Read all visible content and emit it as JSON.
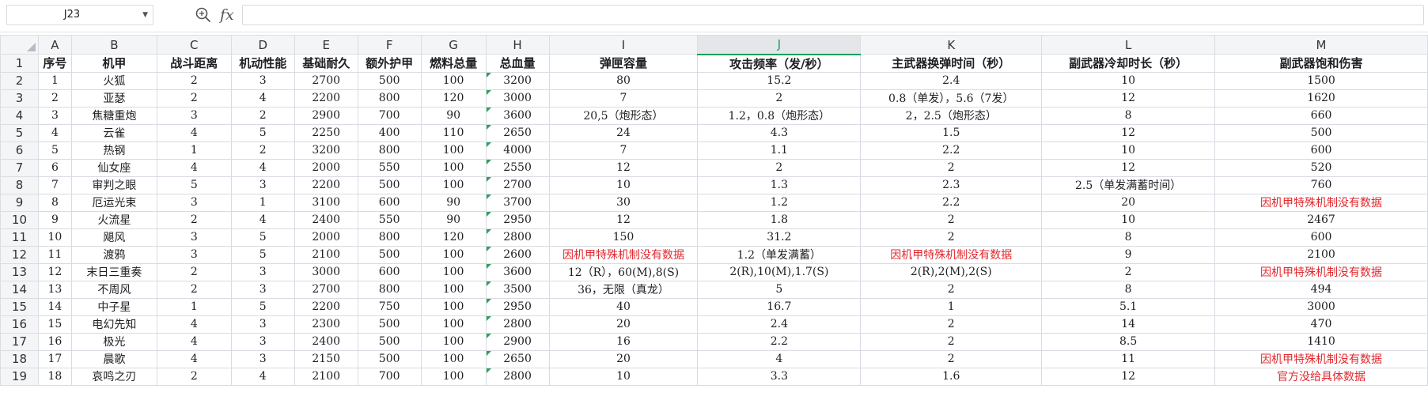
{
  "formula_bar": {
    "name_box": "J23",
    "fx_label": "fx",
    "formula": ""
  },
  "colors": {
    "accent": "#1e9e5e",
    "warning_text": "#e0282e",
    "header_bg": "#f4f5f7"
  },
  "columns": [
    "A",
    "B",
    "C",
    "D",
    "E",
    "F",
    "G",
    "H",
    "I",
    "J",
    "K",
    "L",
    "M"
  ],
  "selected_column": "J",
  "row_numbers": [
    "1",
    "2",
    "3",
    "4",
    "5",
    "6",
    "7",
    "8",
    "9",
    "10",
    "11",
    "12",
    "13",
    "14",
    "15",
    "16",
    "17",
    "18",
    "19"
  ],
  "header_row": [
    "序号",
    "机甲",
    "战斗距离",
    "机动性能",
    "基础耐久",
    "额外护甲",
    "燃料总量",
    "总血量",
    "弹匣容量",
    "攻击频率（发/秒）",
    "主武器换弹时间（秒）",
    "副武器冷却时长（秒）",
    "副武器饱和伤害"
  ],
  "rows": [
    [
      "1",
      "火狐",
      "2",
      "3",
      "2700",
      "500",
      "100",
      "3200",
      "80",
      "15.2",
      "2.4",
      "10",
      "1500"
    ],
    [
      "2",
      "亚瑟",
      "2",
      "4",
      "2200",
      "800",
      "120",
      "3000",
      "7",
      "2",
      "0.8（单发），5.6（7发）",
      "12",
      "1620"
    ],
    [
      "3",
      "焦糖重炮",
      "3",
      "2",
      "2900",
      "700",
      "90",
      "3600",
      "20,5（炮形态）",
      "1.2，0.8（炮形态）",
      "2，2.5（炮形态）",
      "8",
      "660"
    ],
    [
      "4",
      "云雀",
      "4",
      "5",
      "2250",
      "400",
      "110",
      "2650",
      "24",
      "4.3",
      "1.5",
      "12",
      "500"
    ],
    [
      "5",
      "热钢",
      "1",
      "2",
      "3200",
      "800",
      "100",
      "4000",
      "7",
      "1.1",
      "2.2",
      "10",
      "600"
    ],
    [
      "6",
      "仙女座",
      "4",
      "4",
      "2000",
      "550",
      "100",
      "2550",
      "12",
      "2",
      "2",
      "12",
      "520"
    ],
    [
      "7",
      "审判之眼",
      "5",
      "3",
      "2200",
      "500",
      "100",
      "2700",
      "10",
      "1.3",
      "2.3",
      "2.5（单发满蓄时间）",
      "760"
    ],
    [
      "8",
      "厄运光束",
      "3",
      "1",
      "3100",
      "600",
      "90",
      "3700",
      "30",
      "1.2",
      "2.2",
      "20",
      "因机甲特殊机制没有数据"
    ],
    [
      "9",
      "火流星",
      "2",
      "4",
      "2400",
      "550",
      "90",
      "2950",
      "12",
      "1.8",
      "2",
      "10",
      "2467"
    ],
    [
      "10",
      "飓风",
      "3",
      "5",
      "2000",
      "800",
      "120",
      "2800",
      "150",
      "31.2",
      "2",
      "8",
      "600"
    ],
    [
      "11",
      "渡鸦",
      "3",
      "5",
      "2100",
      "500",
      "100",
      "2600",
      "因机甲特殊机制没有数据",
      "1.2（单发满蓄）",
      "因机甲特殊机制没有数据",
      "9",
      "2100"
    ],
    [
      "12",
      "末日三重奏",
      "2",
      "3",
      "3000",
      "600",
      "100",
      "3600",
      "12（R），60(M),8(S)",
      "2(R),10(M),1.7(S)",
      "2(R),2(M),2(S)",
      "2",
      "因机甲特殊机制没有数据"
    ],
    [
      "13",
      "不周风",
      "2",
      "3",
      "2700",
      "800",
      "100",
      "3500",
      "36，无限（真龙）",
      "5",
      "2",
      "8",
      "494"
    ],
    [
      "14",
      "中子星",
      "1",
      "5",
      "2200",
      "750",
      "100",
      "2950",
      "40",
      "16.7",
      "1",
      "5.1",
      "3000"
    ],
    [
      "15",
      "电幻先知",
      "4",
      "3",
      "2300",
      "500",
      "100",
      "2800",
      "20",
      "2.4",
      "2",
      "14",
      "470"
    ],
    [
      "16",
      "极光",
      "4",
      "3",
      "2400",
      "500",
      "100",
      "2900",
      "16",
      "2.2",
      "2",
      "8.5",
      "1410"
    ],
    [
      "17",
      "晨歌",
      "4",
      "3",
      "2150",
      "500",
      "100",
      "2650",
      "20",
      "4",
      "2",
      "11",
      "因机甲特殊机制没有数据"
    ],
    [
      "18",
      "哀鸣之刃",
      "2",
      "4",
      "2100",
      "700",
      "100",
      "2800",
      "10",
      "3.3",
      "1.6",
      "12",
      "官方没给具体数据"
    ]
  ]
}
